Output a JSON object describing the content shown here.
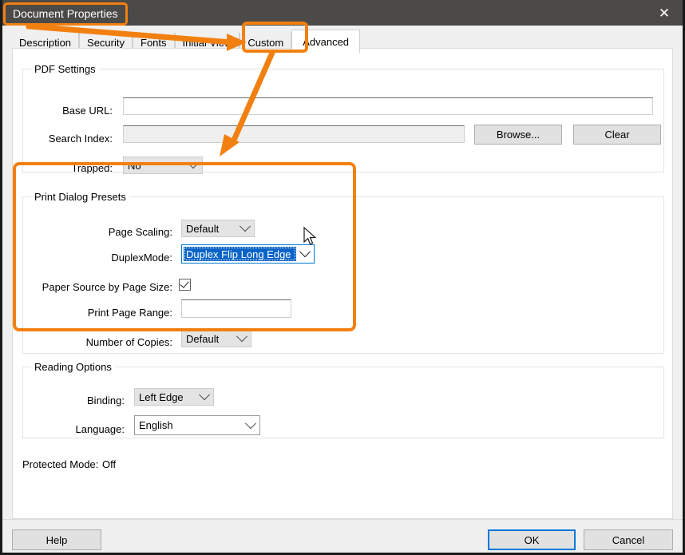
{
  "window": {
    "title_annotation": "Document Properties",
    "close_icon": "close-icon",
    "titlebar_color": "#4b4a48",
    "accent_color": "#f28010"
  },
  "tabs": [
    {
      "label": "Description",
      "active": false
    },
    {
      "label": "Security",
      "active": false
    },
    {
      "label": "Fonts",
      "active": false
    },
    {
      "label": "Initial View",
      "active": false
    },
    {
      "label": "Custom",
      "active": false
    },
    {
      "label": "Advanced",
      "active": true
    }
  ],
  "pdf_settings": {
    "group_label": "PDF Settings",
    "base_url": {
      "label": "Base URL:",
      "value": "",
      "placeholder": ""
    },
    "search_index": {
      "label": "Search Index:",
      "value": "",
      "placeholder": ""
    },
    "browse_button": "Browse...",
    "clear_button": "Clear",
    "trapped": {
      "label": "Trapped:",
      "value": "No"
    }
  },
  "print_dialog_presets": {
    "group_label": "Print Dialog Presets",
    "page_scaling": {
      "label": "Page Scaling:",
      "value": "Default"
    },
    "duplex_mode": {
      "label": "DuplexMode:",
      "value": "Duplex Flip Long Edge"
    },
    "paper_source": {
      "label": "Paper Source by Page Size:",
      "checked": true
    },
    "print_page_range": {
      "label": "Print Page Range:",
      "value": ""
    },
    "number_of_copies": {
      "label": "Number of Copies:",
      "value": "Default"
    }
  },
  "reading_options": {
    "group_label": "Reading Options",
    "binding": {
      "label": "Binding:",
      "value": "Left Edge"
    },
    "language": {
      "label": "Language:",
      "value": "English"
    }
  },
  "protected_mode": {
    "label": "Protected Mode:",
    "value": "Off"
  },
  "footer": {
    "help": "Help",
    "ok": "OK",
    "cancel": "Cancel"
  }
}
